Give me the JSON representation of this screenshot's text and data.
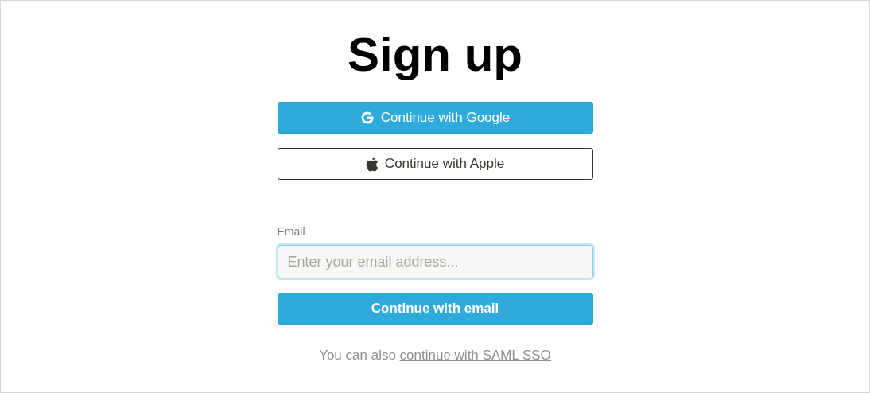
{
  "title": "Sign up",
  "social_buttons": [
    {
      "kind": "google",
      "label": "Continue with Google"
    },
    {
      "kind": "apple",
      "label": "Continue with Apple"
    }
  ],
  "email_field": {
    "label": "Email",
    "placeholder": "Enter your email address...",
    "focused": true
  },
  "submit_button": {
    "label": "Continue with email"
  },
  "footer": {
    "text": "You can also",
    "link": "continue with SAML SSO"
  }
}
